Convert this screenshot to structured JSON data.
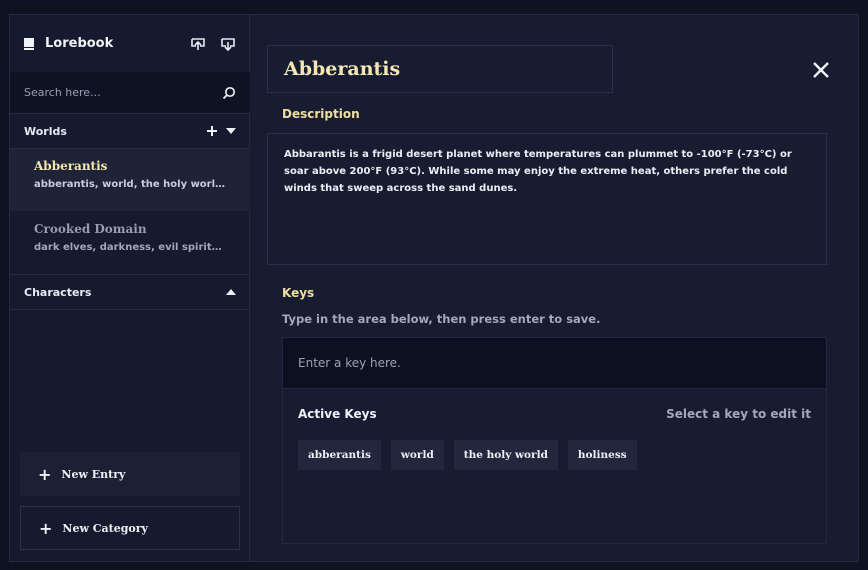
{
  "sidebar": {
    "title": "Lorebook",
    "search_placeholder": "Search here...",
    "sections": {
      "worlds": "Worlds",
      "characters": "Characters"
    },
    "entries": [
      {
        "title": "Abberantis",
        "keys": "abberantis, world, the holy world, holiness"
      },
      {
        "title": "Crooked Domain",
        "keys": "dark elves, darkness, evil spirits, catacombs"
      }
    ],
    "buttons": {
      "new_entry": "New Entry",
      "new_category": "New Category",
      "plus": "+"
    }
  },
  "main": {
    "title": "Abberantis",
    "description_label": "Description",
    "description": "Abbarantis is a frigid desert planet where temperatures can plummet to -100°F (-73°C) or soar above 200°F (93°C). While some may enjoy the extreme heat, others prefer the cold winds that sweep across the sand dunes.",
    "keys_label": "Keys",
    "keys_hint": "Type in the area below, then press enter to save.",
    "key_input_placeholder": "Enter a key here.",
    "active_keys_title": "Active Keys",
    "active_keys_hint": "Select a key to edit it",
    "active_keys": [
      "abberantis",
      "world",
      "the holy world",
      "holiness"
    ]
  },
  "colors": {
    "accent_title": "#f5e7b4",
    "accent_label": "#f0dfa0",
    "background": "#0f1220",
    "panel": "#181c30"
  },
  "icons": [
    "book-icon",
    "upload-icon",
    "download-icon",
    "search-icon",
    "plus-icon",
    "chevron-down-icon",
    "chevron-up-icon",
    "close-icon"
  ]
}
